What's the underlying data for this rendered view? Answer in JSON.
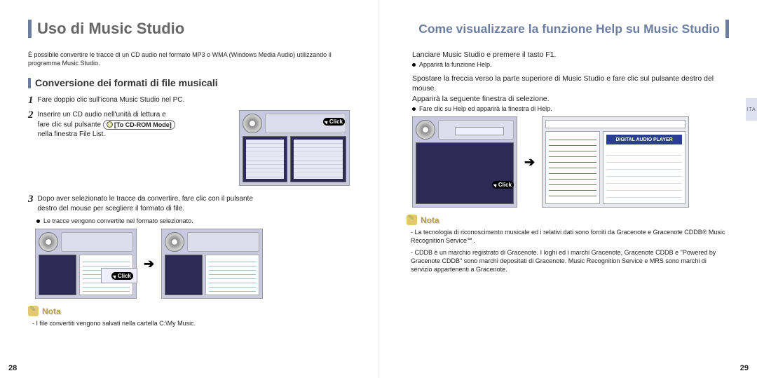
{
  "left": {
    "title": "Uso di Music Studio",
    "intro": "È possibile convertire le tracce di un CD audio nel formato MP3 o WMA (Windows Media Audio) utilizzando il programma Music Studio.",
    "section": "Conversione dei formati di file musicali",
    "step1_num": "1",
    "step1": "Fare doppio clic sull'icona Music Studio nel PC.",
    "step2_num": "2",
    "step2_line1": "Inserire un CD audio nell'unità di lettura e",
    "step2_line2_a": "fare clic sul pulsante ",
    "step2_chip": "To CD-ROM Mode",
    "step2_line3": "nella finestra File List.",
    "step3_num": "3",
    "step3_a": "Dopo aver selezionato le tracce da convertire, fare clic con il pulsante",
    "step3_b": "destro del mouse per scegliere il formato di file.",
    "step3_bullet": "Le tracce vengono convertite nel formato selezionato.",
    "click": "Click",
    "nota_label": "Nota",
    "nota_text": "- I file convertiti vengono salvati nella cartella C:\\My Music.",
    "page_num": "28"
  },
  "right": {
    "title": "Come visualizzare la funzione Help su Music Studio",
    "step_a": "Lanciare Music Studio e premere il tasto F1.",
    "step_a_bullet": "Apparirà la funzione Help.",
    "step_b1": "Spostare la freccia verso la parte superiore di Music Studio e fare clic sul pulsante destro del mouse.",
    "step_b2": "Apparirà la seguente finestra di selezione.",
    "step_b_bullet": "Fare clic su Help ed apparirà la finestra di Help.",
    "click": "Click",
    "nota_label": "Nota",
    "nota_text1": "- La tecnologia di riconoscimento musicale ed i relativi dati sono forniti da Gracenote e Gracenote CDDB® Music Recognition Service℠.",
    "nota_text2": "- CDDB è un marchio registrato di Gracenote. I loghi ed i marchi Gracenote, Gracenote CDDB e \"Powered by Gracenote CDDB\" sono marchi depositati di Gracenote. Music Recognition Service e MRS sono marchi di servizio appartenenti a Gracenote.",
    "page_num": "29",
    "side_tab": "ITA",
    "help_panel_title": "DIGITAL AUDIO PLAYER"
  }
}
